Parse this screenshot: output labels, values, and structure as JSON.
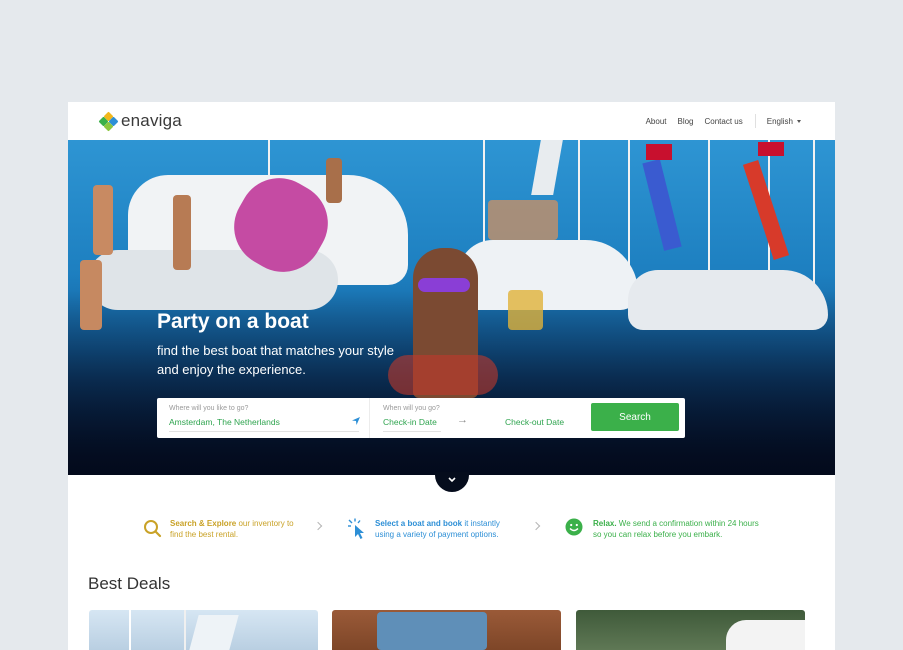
{
  "header": {
    "logo_text": "enaviga",
    "nav": [
      {
        "label": "About"
      },
      {
        "label": "Blog"
      },
      {
        "label": "Contact us"
      }
    ],
    "language": "English"
  },
  "hero": {
    "title": "Party on a boat",
    "subtitle": "find the best boat that matches your style and enjoy the experience."
  },
  "search": {
    "where_label": "Where will you like to go?",
    "where_value": "Amsterdam, The Netherlands",
    "when_label": "When will you go?",
    "checkin": "Check-in Date",
    "checkout": "Check-out Date",
    "button": "Search"
  },
  "steps": [
    {
      "strong": "Search & Explore",
      "rest": " our inventory to find the best rental.",
      "color": "#c9a227"
    },
    {
      "strong": "Select a boat and book",
      "rest": " it instantly using a variety of payment options.",
      "color": "#2d8fd6"
    },
    {
      "strong": "Relax.",
      "rest": " We send a confirmation within 24 hours so you can relax before you embark.",
      "color": "#3bb04a"
    }
  ],
  "best_deals_title": "Best Deals",
  "colors": {
    "accent": "#3bb04a",
    "link_blue": "#2d8fd6",
    "gold": "#c9a227"
  }
}
